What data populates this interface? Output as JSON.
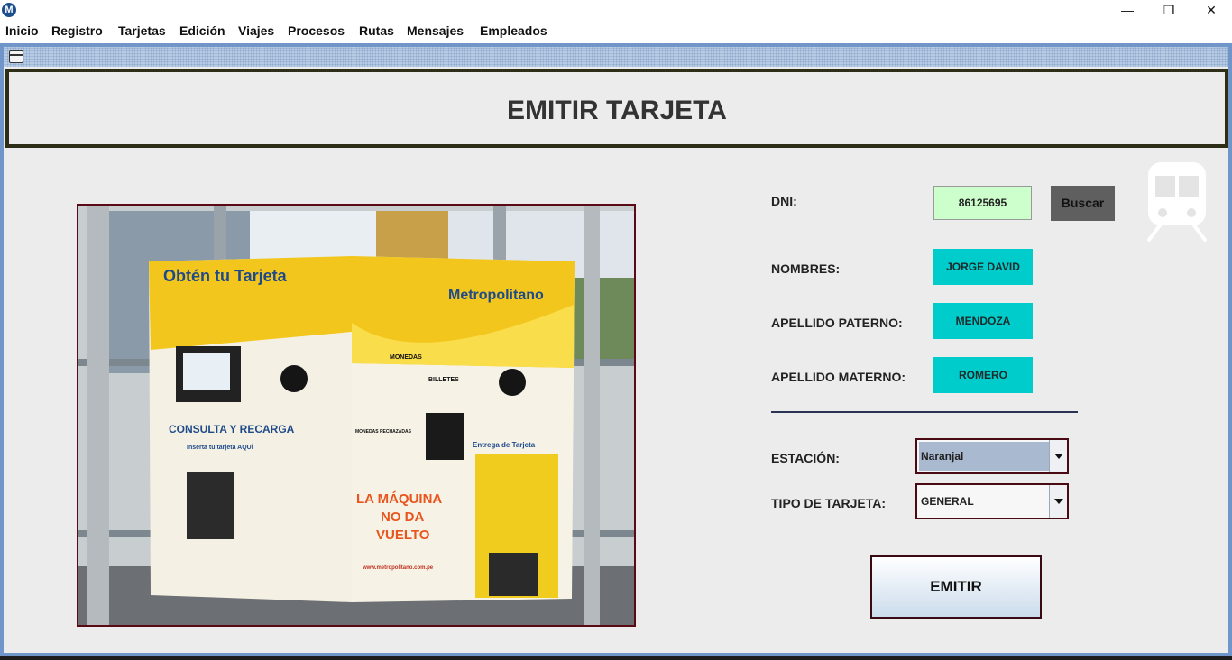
{
  "window": {
    "app_icon": "M",
    "minimize": "—",
    "maximize": "❐",
    "close": "✕"
  },
  "menu": [
    "Inicio",
    "Registro",
    "Tarjetas",
    "Edición",
    "Viajes",
    "Procesos",
    "Rutas",
    "Mensajes",
    "Empleados"
  ],
  "header": {
    "title": "EMITIR TARJETA"
  },
  "image": {
    "description_icon": "train-icon",
    "photo_texts": {
      "obten": "Obtén tu Tarjeta",
      "brand": "Metropolitano",
      "consulta": "CONSULTA Y RECARGA",
      "inserta": "Inserta tu tarjeta AQUÍ",
      "monedas": "MONEDAS",
      "billetes": "BILLETES",
      "monedas_rechazadas": "MONEDAS RECHAZADAS",
      "entrega": "Entrega de Tarjeta",
      "no_vuelto_1": "LA MÁQUINA",
      "no_vuelto_2": "NO DA",
      "no_vuelto_3": "VUELTO",
      "web": "www.metropolitano.com.pe"
    }
  },
  "form": {
    "dni_label": "DNI:",
    "dni_value": "86125695",
    "buscar_label": "Buscar",
    "nombres_label": "NOMBRES:",
    "nombres_value": "JORGE DAVID",
    "paterno_label": "APELLIDO PATERNO:",
    "paterno_value": "MENDOZA",
    "materno_label": "APELLIDO MATERNO:",
    "materno_value": "ROMERO",
    "estacion_label": "ESTACIÓN:",
    "estacion_value": "Naranjal",
    "tipo_label": "TIPO DE TARJETA:",
    "tipo_value": "GENERAL",
    "emitir_label": "EMITIR"
  },
  "colors": {
    "header_border": "#2d2d18",
    "dni_bg": "#ccffcc",
    "value_bg": "#00cccc",
    "buscar_bg": "#5f5f5f",
    "estacion_bg": "#a9b9cf"
  }
}
